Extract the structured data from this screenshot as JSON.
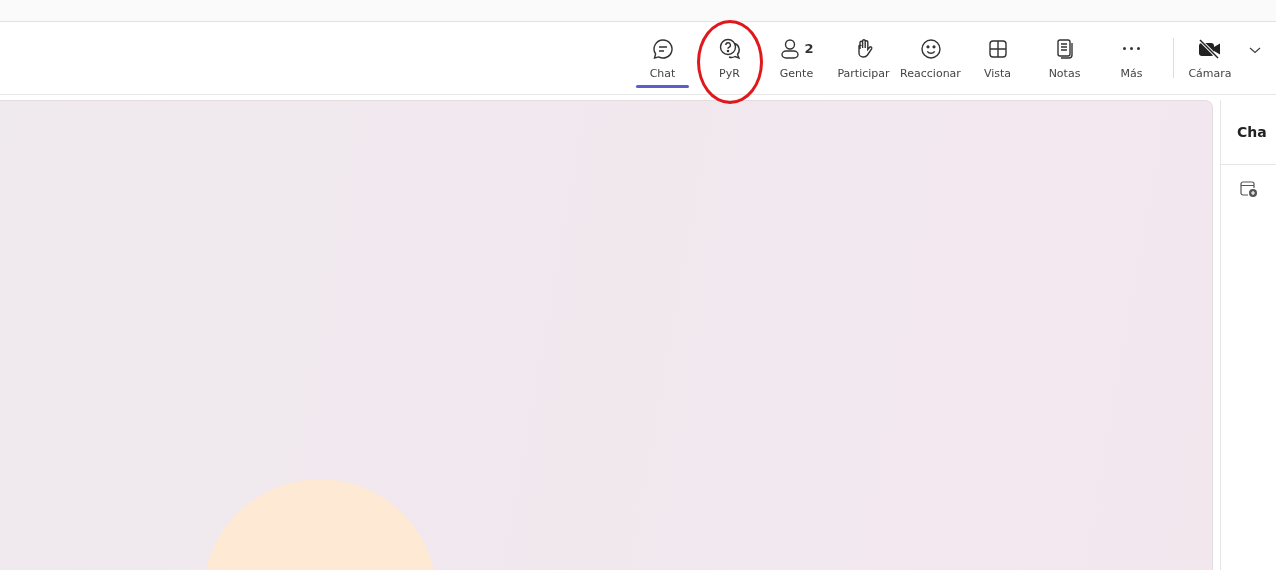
{
  "toolbar": {
    "items": [
      {
        "kind": "chat",
        "label": "Chat",
        "selected": true,
        "circled": false
      },
      {
        "kind": "qa",
        "label": "PyR",
        "selected": false,
        "circled": true
      },
      {
        "kind": "people",
        "label": "Gente",
        "count": "2",
        "selected": false,
        "circled": false
      },
      {
        "kind": "hand",
        "label": "Participar",
        "selected": false,
        "circled": false
      },
      {
        "kind": "smile",
        "label": "Reaccionar",
        "selected": false,
        "circled": false
      },
      {
        "kind": "grid",
        "label": "Vista",
        "selected": false,
        "circled": false
      },
      {
        "kind": "notes",
        "label": "Notas",
        "selected": false,
        "circled": false
      },
      {
        "kind": "more",
        "label": "Más",
        "selected": false,
        "circled": false
      }
    ],
    "camera": {
      "label": "Cámara",
      "on": false
    }
  },
  "stage": {
    "participant": {
      "kind": "avatar"
    }
  },
  "chat_panel": {
    "title": "Cha"
  }
}
